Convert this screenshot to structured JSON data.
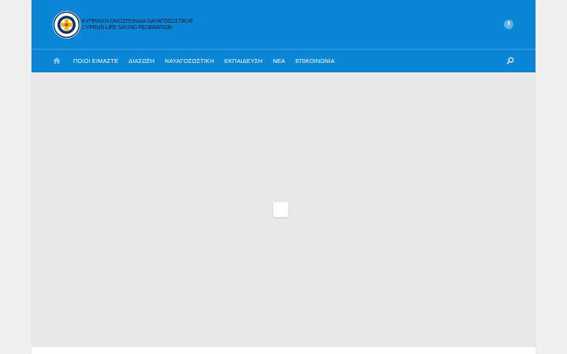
{
  "brand": {
    "line1": "ΚΥΠΡΙΑΚΗ ΟΜΟΣΠΟΝΔΙΑ ΝΑΥΑΓΟΣΩΣΤΙΚΗΣ",
    "line2": "CYPRUS LIFE SAVING FEDERATION"
  },
  "social": {
    "facebook_glyph": "f"
  },
  "nav": {
    "home_icon": "home-icon",
    "items": [
      {
        "label": "ΠΟΙΟΙ ΕΙΜΑΣΤΕ"
      },
      {
        "label": "ΔΙΑΣΩΣΗ"
      },
      {
        "label": "ΝΑΥΑΓΟΣΩΣΤΙΚΗ"
      },
      {
        "label": "ΕΚΠΑΙΔΕΥΣΗ"
      },
      {
        "label": "ΝΕΑ"
      },
      {
        "label": "ΕΠΙΚΟΙΝΩΝΙΑ"
      }
    ],
    "search_icon": "search-icon"
  },
  "colors": {
    "header": "#0b86d6",
    "content": "#e8e8e8",
    "background": "#efefef"
  }
}
